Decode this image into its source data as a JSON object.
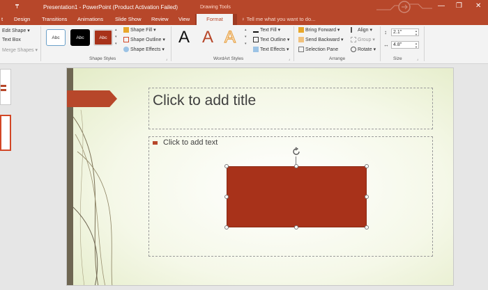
{
  "titlebar": {
    "title": "Presentation1 - PowerPoint (Product Activation Failed)",
    "qat": "₸",
    "minimize": "—",
    "restore": "❐",
    "close": "✕"
  },
  "tabs": {
    "items": [
      "t",
      "Design",
      "Transitions",
      "Animations",
      "Slide Show",
      "Review",
      "View"
    ],
    "contextual_group": "Drawing Tools",
    "active": "Format",
    "tell_me": "Tell me what you want to do..."
  },
  "ribbon": {
    "insert_shapes": {
      "edit_shape": "Edit Shape",
      "text_box": "Text Box",
      "merge_shapes": "Merge Shapes"
    },
    "shape_styles": {
      "thumb_labels": [
        "Abc",
        "Abc",
        "Abc"
      ],
      "fill": "Shape Fill",
      "outline": "Shape Outline",
      "effects": "Shape Effects",
      "group_label": "Shape Styles"
    },
    "wordart": {
      "letters": [
        "A",
        "A",
        "A"
      ],
      "text_fill": "Text Fill",
      "text_outline": "Text Outline",
      "text_effects": "Text Effects",
      "group_label": "WordArt Styles"
    },
    "arrange": {
      "bring_forward": "Bring Forward",
      "send_backward": "Send Backward",
      "selection_pane": "Selection Pane",
      "align": "Align",
      "group": "Group",
      "rotate": "Rotate",
      "group_label": "Arrange"
    },
    "size": {
      "height": "2.1\"",
      "width": "4.8\"",
      "group_label": "Size"
    }
  },
  "slide": {
    "title_placeholder": "Click to add title",
    "body_placeholder": "Click to add text"
  },
  "colors": {
    "accent": "#b7472a",
    "shape_fill": "#a8321a"
  }
}
